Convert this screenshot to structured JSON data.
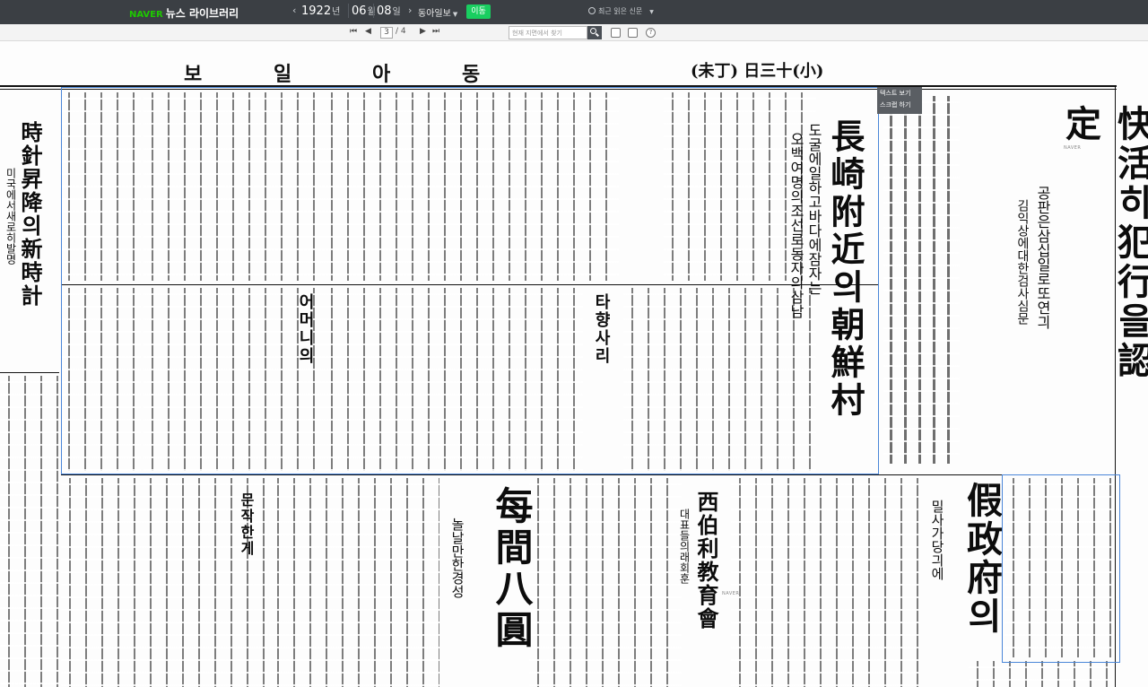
{
  "topbar": {
    "brand_logo": "NAVER",
    "brand_title": "뉴스 라이브러리",
    "date": {
      "year": "1922",
      "year_unit": "년",
      "month": "06",
      "month_unit": "월",
      "day": "08",
      "day_unit": "일"
    },
    "paper_name": "동아일보",
    "go_label": "이동",
    "recent_label": "최근 읽은 신문"
  },
  "toolbar": {
    "current_page": "3",
    "total_pages": "/ 4",
    "search_placeholder": "현재 지면에서 찾기"
  },
  "popup": {
    "view_text": "텍스트 보기",
    "scrap": "스크랩 하기"
  },
  "newspaper": {
    "masthead_kr": [
      "보",
      "일",
      "아",
      "동"
    ],
    "masthead_date": "(未丁)  日三十(小)",
    "headlines": {
      "kwaehwal": "快活히犯行을認定",
      "kwaehwal_sub": "공판은삼십일로또연긔",
      "kwaehwal_sub2": "김익상에대한검사심문",
      "nagasaki": "長崎附近의朝鮮村",
      "nagasaki_sub": "오백여명의조선로동자의삼남",
      "nagasaki_sub2": "도굴에일하고바다에잠자는",
      "clock": "時針昇降의新時計",
      "clock_sub": "미국에서새로히발명",
      "provisional": "假政府의",
      "provisional_sub": "밀사가당긔에",
      "siberia": "西伯利教育會",
      "siberia_sub": "대표들의래회훈",
      "eight_yen": "每間八圓",
      "eight_yen_sub": "놀날만한경성",
      "mother": "어머니의",
      "fake": "문작한게",
      "hometown": "타향사리"
    }
  }
}
